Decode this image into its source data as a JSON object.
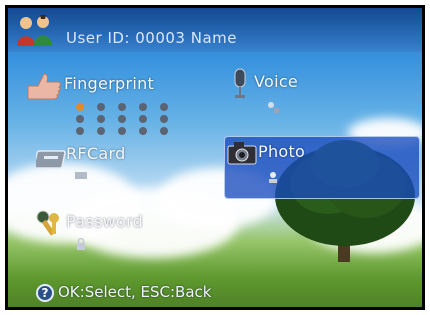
{
  "header": {
    "title": "User ID: 00003  Name",
    "icon": "users-icon"
  },
  "menu": {
    "fingerprint": {
      "label": "Fingerprint",
      "icon": "thumb-up-icon",
      "slots_total": 15,
      "slots_filled": 1
    },
    "voice": {
      "label": "Voice",
      "icon": "microphone-icon"
    },
    "rfcard": {
      "label": "RFCard",
      "icon": "card-icon"
    },
    "photo": {
      "label": "Photo",
      "icon": "camera-icon",
      "selected": true
    },
    "password": {
      "label": "Password",
      "icon": "keys-icon"
    }
  },
  "footer": {
    "hint": "OK:Select, ESC:Back",
    "icon": "help-icon",
    "icon_glyph": "?"
  },
  "colors": {
    "highlight": "#1e4fc0",
    "dot_filled": "#e08a2a",
    "dot_empty": "#5b6472"
  }
}
